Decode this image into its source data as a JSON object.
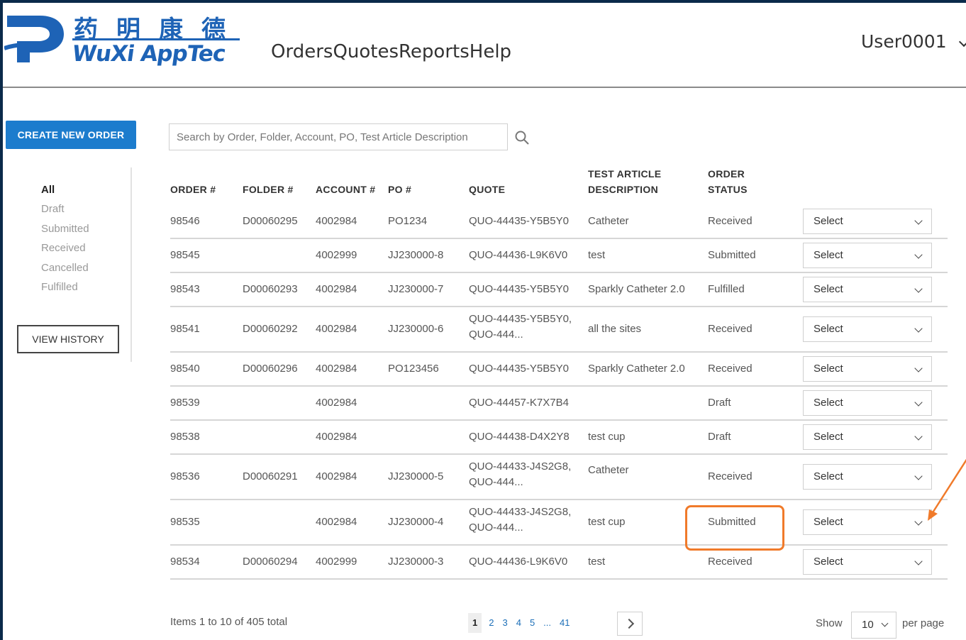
{
  "header": {
    "logo_cn": "药明康德",
    "logo_en": "WuXi AppTec",
    "nav": [
      "Orders",
      "Quotes",
      "Reports",
      "Help"
    ],
    "user": "User0001"
  },
  "sidebar": {
    "create_label": "CREATE NEW ORDER",
    "filters": [
      "All",
      "Draft",
      "Submitted",
      "Received",
      "Cancelled",
      "Fulfilled"
    ],
    "active_filter": "All",
    "history_label": "VIEW HISTORY"
  },
  "search": {
    "placeholder": "Search by Order, Folder, Account, PO, Test Article Description",
    "icon": "search-icon"
  },
  "table": {
    "headers": {
      "order": "ORDER #",
      "folder": "FOLDER #",
      "account": "ACCOUNT #",
      "po": "PO #",
      "quote": "QUOTE",
      "desc_line1": "TEST ARTICLE",
      "desc_line2": "DESCRIPTION",
      "status_line1": "ORDER",
      "status_line2": "STATUS"
    },
    "rows": [
      {
        "order": "98546",
        "folder": "D00060295",
        "account": "4002984",
        "po": "PO1234",
        "quote1": "QUO-44435-Y5B5Y0",
        "quote2": "",
        "desc": "Catheter",
        "status": "Received",
        "action": "Select"
      },
      {
        "order": "98545",
        "folder": "",
        "account": "4002999",
        "po": "JJ230000-8",
        "quote1": "QUO-44436-L9K6V0",
        "quote2": "",
        "desc": "test",
        "status": "Submitted",
        "action": "Select"
      },
      {
        "order": "98543",
        "folder": "D00060293",
        "account": "4002984",
        "po": "JJ230000-7",
        "quote1": "QUO-44435-Y5B5Y0",
        "quote2": "",
        "desc": "Sparkly Catheter 2.0",
        "status": "Fulfilled",
        "action": "Select"
      },
      {
        "order": "98541",
        "folder": "D00060292",
        "account": "4002984",
        "po": "JJ230000-6",
        "quote1": "QUO-44435-Y5B5Y0,",
        "quote2": "QUO-444...",
        "desc": "all the sites",
        "status": "Received",
        "action": "Select"
      },
      {
        "order": "98540",
        "folder": "D00060296",
        "account": "4002984",
        "po": "PO123456",
        "quote1": "QUO-44435-Y5B5Y0",
        "quote2": "",
        "desc": "Sparkly Catheter 2.0",
        "status": "Received",
        "action": "Select"
      },
      {
        "order": "98539",
        "folder": "",
        "account": "4002984",
        "po": "",
        "quote1": "QUO-44457-K7X7B4",
        "quote2": "",
        "desc": "",
        "status": "Draft",
        "action": "Select"
      },
      {
        "order": "98538",
        "folder": "",
        "account": "4002984",
        "po": "",
        "quote1": "QUO-44438-D4X2Y8",
        "quote2": "",
        "desc": "test cup",
        "status": "Draft",
        "action": "Select"
      },
      {
        "order": "98536",
        "folder": "D00060291",
        "account": "4002984",
        "po": "JJ230000-5",
        "quote1": "QUO-44433-J4S2G8,",
        "quote2": "QUO-444...",
        "desc": "Catheter",
        "status": "Received",
        "action": "Select"
      },
      {
        "order": "98535",
        "folder": "",
        "account": "4002984",
        "po": "JJ230000-4",
        "quote1": "QUO-44433-J4S2G8,",
        "quote2": "QUO-444...",
        "desc": "test cup",
        "status": "Submitted",
        "action": "Select"
      },
      {
        "order": "98534",
        "folder": "D00060294",
        "account": "4002999",
        "po": "JJ230000-3",
        "quote1": "QUO-44436-L9K6V0",
        "quote2": "",
        "desc": "test",
        "status": "Received",
        "action": "Select"
      }
    ]
  },
  "footer": {
    "items_total": "Items 1 to 10 of 405 total",
    "pages": [
      "1",
      "2",
      "3",
      "4",
      "5",
      "...",
      "41"
    ],
    "current_page": "1",
    "show_label": "Show",
    "per_page_value": "10",
    "per_page_label": "per page"
  },
  "colors": {
    "brand": "#1e63b6",
    "primary_button": "#1c7ccd",
    "highlight": "#f07a2a"
  }
}
